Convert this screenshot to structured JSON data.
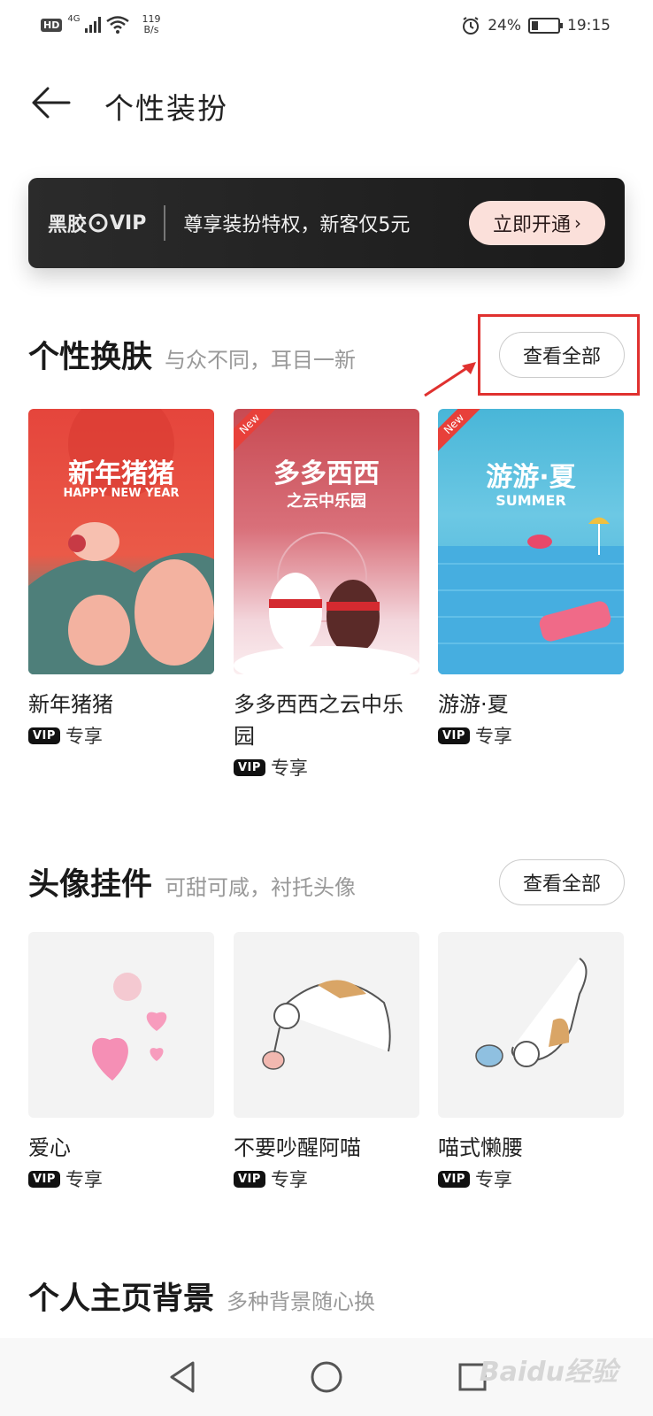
{
  "status_bar": {
    "hd": "HD",
    "network": "4G",
    "speed_value": "119",
    "speed_unit": "B/s",
    "battery": "24%",
    "battery_level": 0.24,
    "time": "19:15"
  },
  "header": {
    "title": "个性装扮"
  },
  "vip_banner": {
    "brand_prefix": "黑胶",
    "brand_vip": "VIP",
    "text": "尊享装扮特权，新客仅5元",
    "cta": "立即开通"
  },
  "skins": {
    "title": "个性换肤",
    "subtitle": "与众不同，耳目一新",
    "view_all": "查看全部",
    "items": [
      {
        "name": "新年猪猪",
        "badge": "专享",
        "vip": "VIP",
        "art_title": "新年猪猪",
        "art_sub": "HAPPY NEW YEAR"
      },
      {
        "name": "多多西西之云中乐园",
        "badge": "专享",
        "vip": "VIP",
        "art_title": "多多西西",
        "art_sub": "之云中乐园",
        "new": "New"
      },
      {
        "name": "游游·夏",
        "badge": "专享",
        "vip": "VIP",
        "art_title": "游游·夏",
        "art_sub": "SUMMER",
        "new": "New"
      }
    ]
  },
  "pendants": {
    "title": "头像挂件",
    "subtitle": "可甜可咸，衬托头像",
    "view_all": "查看全部",
    "items": [
      {
        "name": "爱心",
        "badge": "专享",
        "vip": "VIP"
      },
      {
        "name": "不要吵醒阿喵",
        "badge": "专享",
        "vip": "VIP"
      },
      {
        "name": "喵式懒腰",
        "badge": "专享",
        "vip": "VIP"
      }
    ]
  },
  "backgrounds": {
    "title": "个人主页背景",
    "subtitle": "多种背景随心换"
  },
  "watermark": "Baidu经验"
}
